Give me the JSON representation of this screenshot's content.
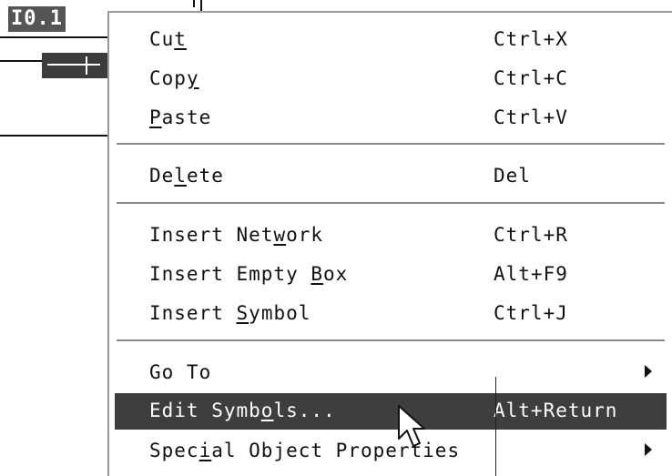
{
  "editor": {
    "address_label": "I0.1"
  },
  "menu": {
    "items": [
      {
        "id": "cut",
        "label_parts": [
          "Cu",
          "t",
          ""
        ],
        "shortcut": "Ctrl+X"
      },
      {
        "id": "copy",
        "label_parts": [
          "Cop",
          "y",
          ""
        ],
        "shortcut": "Ctrl+C"
      },
      {
        "id": "paste",
        "label_parts": [
          "",
          "P",
          "aste"
        ],
        "shortcut": "Ctrl+V"
      },
      {
        "id": "delete",
        "label_parts": [
          "De",
          "l",
          "ete"
        ],
        "shortcut": "Del"
      },
      {
        "id": "insert-network",
        "label_parts": [
          "Insert Net",
          "w",
          "ork"
        ],
        "shortcut": "Ctrl+R"
      },
      {
        "id": "insert-empty-box",
        "label_parts": [
          "Insert Empty ",
          "B",
          "ox"
        ],
        "shortcut": "Alt+F9"
      },
      {
        "id": "insert-symbol",
        "label_parts": [
          "Insert ",
          "S",
          "ymbol"
        ],
        "shortcut": "Ctrl+J"
      },
      {
        "id": "go-to",
        "label_parts": [
          "Go To",
          "",
          ""
        ],
        "shortcut": ""
      },
      {
        "id": "edit-symbols",
        "label_parts": [
          "Edit Symb",
          "o",
          "ls..."
        ],
        "shortcut": "Alt+Return"
      },
      {
        "id": "special-object-properties",
        "label_parts": [
          "Spec",
          "i",
          "al Object Properties"
        ],
        "shortcut": ""
      }
    ],
    "highlighted": "Edit Symbols...",
    "colors": {
      "highlight_bg": "#3e3e3e",
      "highlight_fg": "#ffffff",
      "separator": "#8a8a8a",
      "border": "#9a9a9a"
    }
  },
  "icons": {
    "submenu": "chevron-right-icon",
    "pointer": "mouse-pointer-icon"
  }
}
